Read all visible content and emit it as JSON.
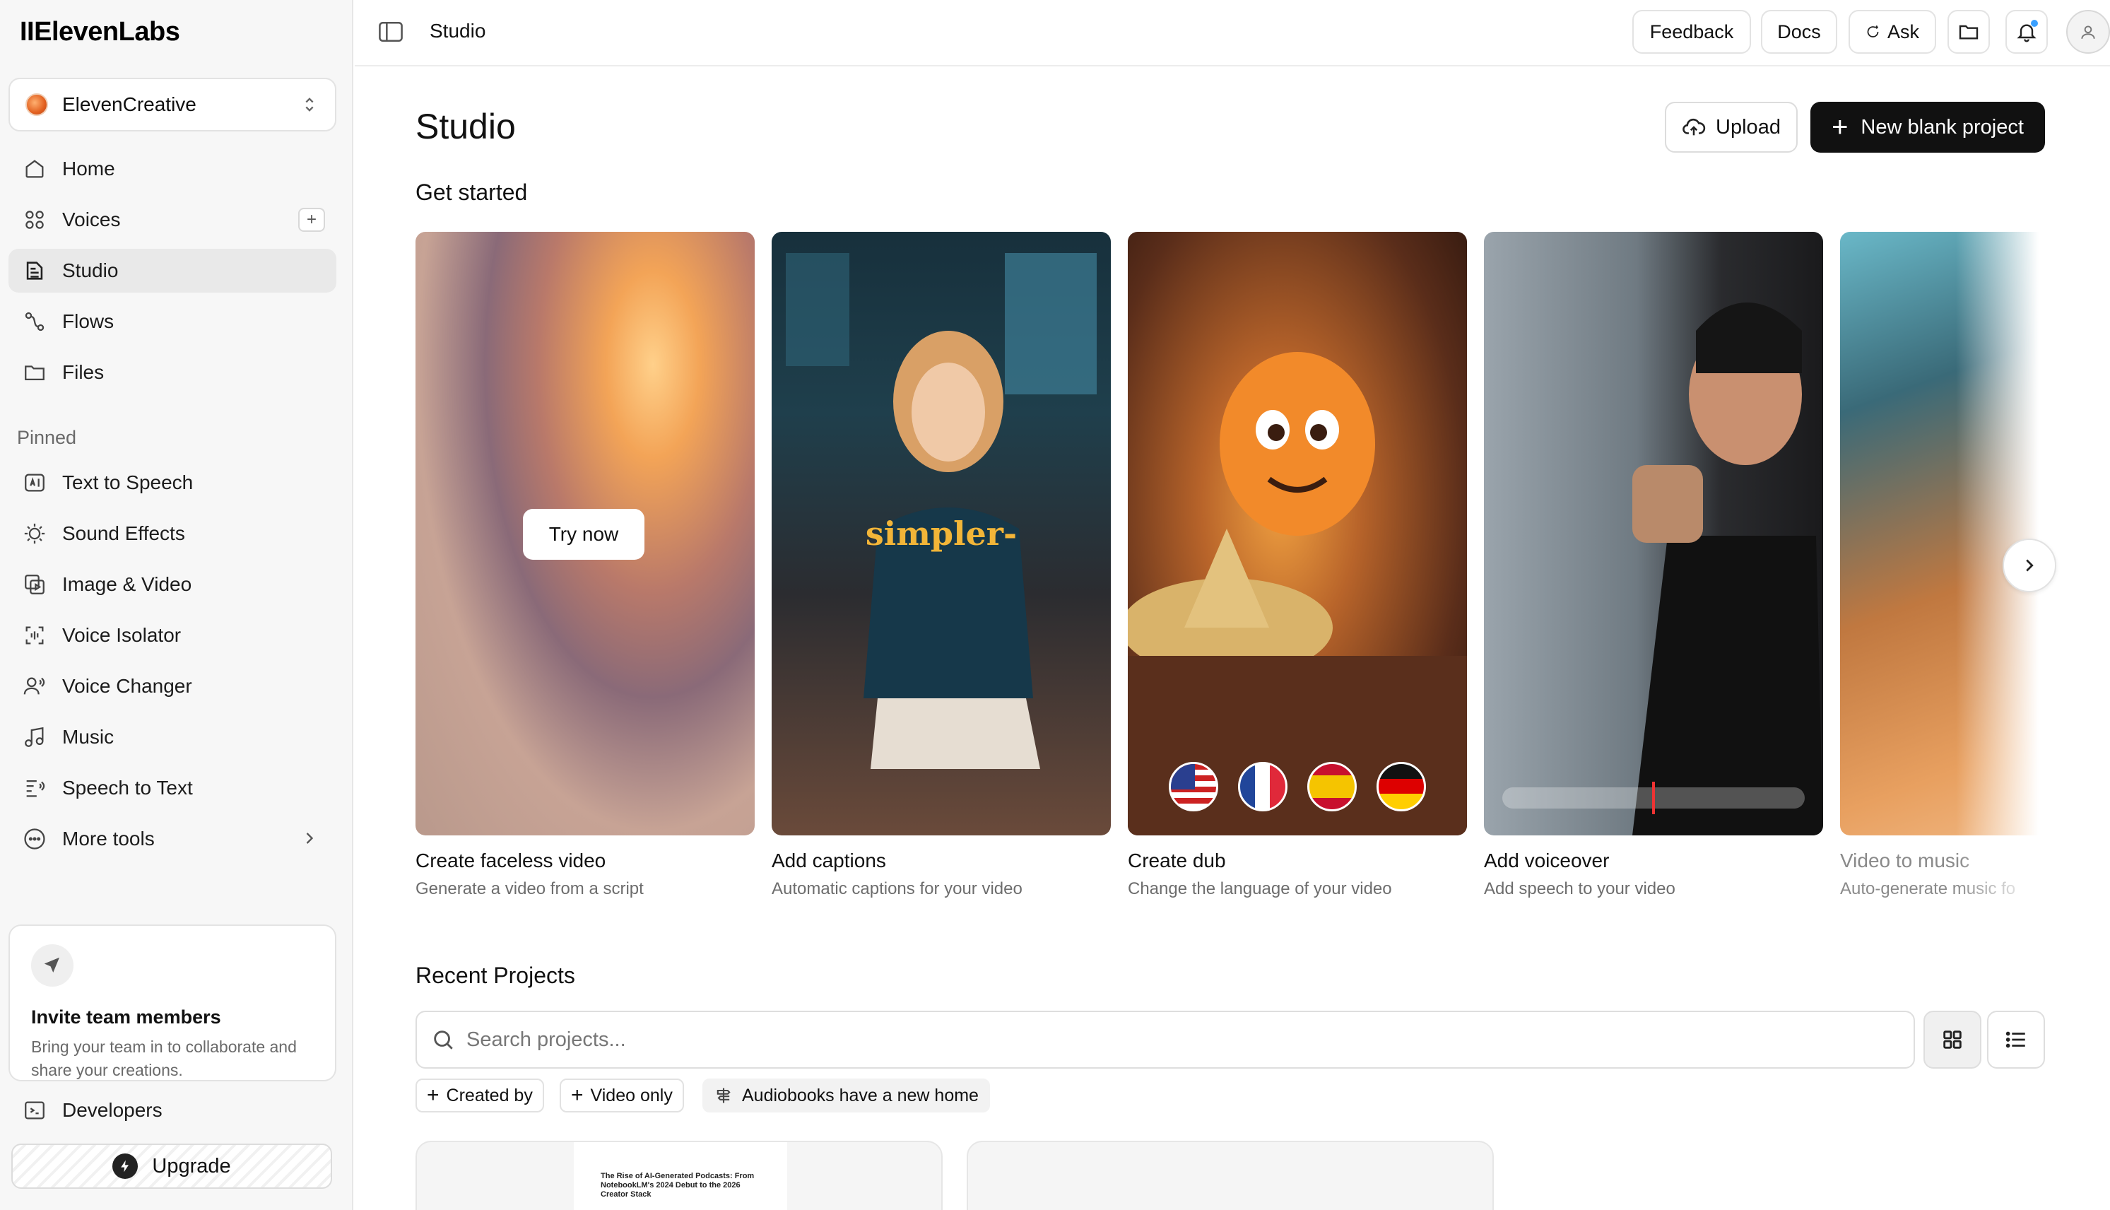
{
  "brand": {
    "logo": "IIElevenLabs"
  },
  "workspace": {
    "name": "ElevenCreative"
  },
  "nav": {
    "main": [
      {
        "label": "Home",
        "icon": "home-icon"
      },
      {
        "label": "Voices",
        "icon": "voices-icon"
      },
      {
        "label": "Studio",
        "icon": "studio-icon",
        "active": true
      },
      {
        "label": "Flows",
        "icon": "flows-icon"
      },
      {
        "label": "Files",
        "icon": "folder-icon"
      }
    ],
    "pinned_label": "Pinned",
    "pinned": [
      {
        "label": "Text to Speech",
        "icon": "text-to-speech-icon"
      },
      {
        "label": "Sound Effects",
        "icon": "sound-effects-icon"
      },
      {
        "label": "Image & Video",
        "icon": "image-video-icon"
      },
      {
        "label": "Voice Isolator",
        "icon": "voice-isolator-icon"
      },
      {
        "label": "Voice Changer",
        "icon": "voice-changer-icon"
      },
      {
        "label": "Music",
        "icon": "music-icon"
      },
      {
        "label": "Speech to Text",
        "icon": "speech-to-text-icon"
      },
      {
        "label": "More tools",
        "icon": "more-icon"
      }
    ],
    "developers": "Developers",
    "upgrade": "Upgrade"
  },
  "invite": {
    "title": "Invite team members",
    "description": "Bring your team in to collaborate and share your creations."
  },
  "topbar": {
    "title": "Studio",
    "feedback": "Feedback",
    "docs": "Docs",
    "ask": "Ask"
  },
  "main": {
    "title": "Studio",
    "upload": "Upload",
    "new_project": "New blank project",
    "get_started": "Get started",
    "cards": [
      {
        "title": "Create faceless video",
        "desc": "Generate a video from a script",
        "cta": "Try now"
      },
      {
        "title": "Add captions",
        "desc": "Automatic captions for your video",
        "overlay": "simpler-"
      },
      {
        "title": "Create dub",
        "desc": "Change the language of your video"
      },
      {
        "title": "Add voiceover",
        "desc": "Add speech to your video"
      },
      {
        "title": "Video to music",
        "desc": "Auto-generate music fo"
      }
    ],
    "recent_projects": "Recent Projects",
    "search_placeholder": "Search projects...",
    "filters": {
      "created_by": "Created by",
      "video_only": "Video only",
      "audiobooks": "Audiobooks have a new home"
    },
    "project_preview": {
      "doc_title": "The Rise of AI-Generated Podcasts: From NotebookLM's 2024 Debut to the 2026 Creator Stack"
    }
  },
  "colors": {
    "accent": "#111111",
    "notification": "#3aa0ff",
    "captions_overlay": "#f2b538"
  }
}
